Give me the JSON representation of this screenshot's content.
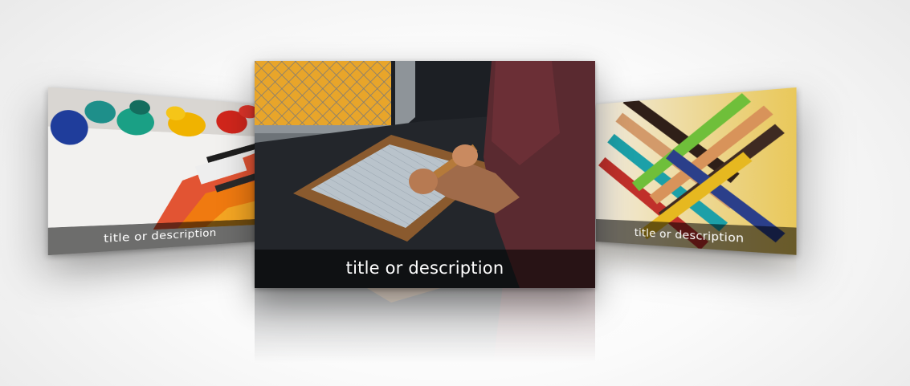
{
  "carousel": {
    "slides": [
      {
        "id": "paint",
        "caption": "title or description"
      },
      {
        "id": "screenprint",
        "caption": "title or description"
      },
      {
        "id": "stripes",
        "caption": "title or description"
      }
    ],
    "active_index": 1
  },
  "colors": {
    "background": "#f4f4f4",
    "caption_bg": "rgba(0,0,0,0.55)",
    "caption_text": "#ffffff"
  }
}
